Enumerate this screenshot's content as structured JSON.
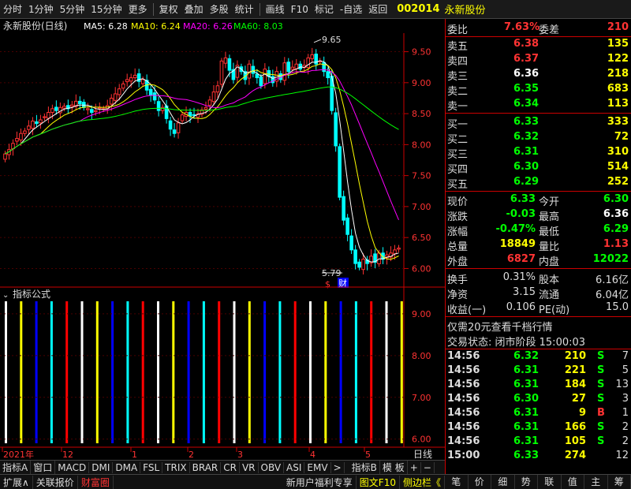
{
  "toolbar": {
    "items": [
      "分时",
      "1分钟",
      "5分钟",
      "15分钟",
      "更多",
      "复权",
      "叠加",
      "多股",
      "统计",
      "画线",
      "F10",
      "标记",
      "-自选",
      "返回"
    ],
    "code": "002014",
    "name": "永新股份"
  },
  "chart_header": {
    "title": "永新股份(日线)",
    "ma5": "MA5: 6.28",
    "ma10": "MA10: 6.24",
    "ma20": "MA20: 6.26",
    "ma60": "MA60: 8.03"
  },
  "indicator_header": "指标公式",
  "annotations": {
    "high": "9.65",
    "low": "5.79",
    "marker1": "$",
    "marker2": "财"
  },
  "xaxis": {
    "labels": [
      "2021年",
      "12",
      "1",
      "2",
      "3",
      "4",
      "5"
    ],
    "period": "日线"
  },
  "colors": {
    "ma5": "#ffffff",
    "ma10": "#ffff00",
    "ma20": "#ff00ff",
    "ma60": "#00ff00",
    "up": "#ff3232",
    "down": "#00ffff",
    "grid": "#8b0000"
  },
  "chart_data": {
    "type": "candlestick",
    "title": "永新股份(日线)",
    "ylim": [
      5.7,
      9.8
    ],
    "y_ticks": [
      6.0,
      6.5,
      7.0,
      7.5,
      8.0,
      8.5,
      9.0,
      9.5
    ],
    "close": [
      7.85,
      7.92,
      8.02,
      8.1,
      8.18,
      8.22,
      8.3,
      8.38,
      8.34,
      8.4,
      8.45,
      8.52,
      8.58,
      8.55,
      8.6,
      8.62,
      8.58,
      8.64,
      8.7,
      8.66,
      8.6,
      8.58,
      8.52,
      8.55,
      8.6,
      8.58,
      8.63,
      8.75,
      8.82,
      8.9,
      8.98,
      9.05,
      9.08,
      9.12,
      9.02,
      9.05,
      8.88,
      8.8,
      8.72,
      8.55,
      8.6,
      8.42,
      8.25,
      8.18,
      8.35,
      8.48,
      8.52,
      8.46,
      8.48,
      8.5,
      8.56,
      8.6,
      8.72,
      8.85,
      8.95,
      9.35,
      9.4,
      9.2,
      9.05,
      9.28,
      9.18,
      9.05,
      9.3,
      9.15,
      9.08,
      8.95,
      9.22,
      9.1,
      9.0,
      9.18,
      9.05,
      9.32,
      9.18,
      9.25,
      9.3,
      9.22,
      9.28,
      9.4,
      9.45,
      9.3,
      9.35,
      9.18,
      9.08,
      8.55,
      7.98,
      7.15,
      6.78,
      6.55,
      6.3,
      6.08,
      6.02,
      6.15,
      6.08,
      6.2,
      6.1,
      6.25,
      6.15,
      6.22,
      6.25,
      6.3,
      6.33
    ],
    "volume_bars": [
      {
        "color": "white"
      },
      {
        "color": "yellow"
      },
      {
        "color": "blue"
      },
      {
        "color": "cyan"
      },
      {
        "color": "red"
      },
      {
        "color": "white"
      },
      {
        "color": "yellow"
      },
      {
        "color": "blue"
      },
      {
        "color": "cyan"
      },
      {
        "color": "red"
      },
      {
        "color": "white"
      },
      {
        "color": "yellow"
      },
      {
        "color": "blue"
      },
      {
        "color": "cyan"
      },
      {
        "color": "red"
      },
      {
        "color": "white"
      },
      {
        "color": "yellow"
      },
      {
        "color": "blue"
      },
      {
        "color": "cyan"
      },
      {
        "color": "red"
      },
      {
        "color": "white"
      },
      {
        "color": "yellow"
      },
      {
        "color": "blue"
      },
      {
        "color": "cyan"
      },
      {
        "color": "red"
      },
      {
        "color": "white"
      },
      {
        "color": "yellow"
      }
    ],
    "indicator_y_ticks": [
      6.0,
      7.0,
      8.0,
      9.0
    ]
  },
  "quote": {
    "weibi_label": "委比",
    "weibi_value": "7.63%",
    "weicha_label": "委差",
    "weicha_value": "210",
    "sells": [
      {
        "label": "卖五",
        "price": "6.38",
        "vol": "135"
      },
      {
        "label": "卖四",
        "price": "6.37",
        "vol": "122"
      },
      {
        "label": "卖三",
        "price": "6.36",
        "vol": "218"
      },
      {
        "label": "卖二",
        "price": "6.35",
        "vol": "683"
      },
      {
        "label": "卖一",
        "price": "6.34",
        "vol": "113"
      }
    ],
    "buys": [
      {
        "label": "买一",
        "price": "6.33",
        "vol": "333"
      },
      {
        "label": "买二",
        "price": "6.32",
        "vol": "72"
      },
      {
        "label": "买三",
        "price": "6.31",
        "vol": "310"
      },
      {
        "label": "买四",
        "price": "6.30",
        "vol": "514"
      },
      {
        "label": "买五",
        "price": "6.29",
        "vol": "252"
      }
    ],
    "stats": [
      {
        "l1": "现价",
        "v1": "6.33",
        "l2": "今开",
        "v2": "6.30"
      },
      {
        "l1": "涨跌",
        "v1": "-0.03",
        "l2": "最高",
        "v2": "6.36"
      },
      {
        "l1": "涨幅",
        "v1": "-0.47%",
        "l2": "最低",
        "v2": "6.29"
      },
      {
        "l1": "总量",
        "v1": "18849",
        "l2": "量比",
        "v2": "1.13"
      },
      {
        "l1": "外盘",
        "v1": "6827",
        "l2": "内盘",
        "v2": "12022"
      }
    ],
    "stats2": [
      {
        "l1": "换手",
        "v1": "0.31%",
        "l2": "股本",
        "v2": "6.16亿"
      },
      {
        "l1": "净资",
        "v1": "3.15",
        "l2": "流通",
        "v2": "6.04亿"
      },
      {
        "l1": "收益(一)",
        "v1": "0.106",
        "l2": "PE(动)",
        "v2": "15.0"
      }
    ],
    "promo": "仅需20元查看千档行情",
    "status": "交易状态: 闭市阶段 15:00:03"
  },
  "ticks": [
    {
      "t": "14:56",
      "p": "6.32",
      "v": "210",
      "s": "S",
      "n": "7"
    },
    {
      "t": "14:56",
      "p": "6.31",
      "v": "221",
      "s": "S",
      "n": "5"
    },
    {
      "t": "14:56",
      "p": "6.31",
      "v": "184",
      "s": "S",
      "n": "13"
    },
    {
      "t": "14:56",
      "p": "6.30",
      "v": "27",
      "s": "S",
      "n": "3"
    },
    {
      "t": "14:56",
      "p": "6.31",
      "v": "9",
      "s": "B",
      "n": "1"
    },
    {
      "t": "14:56",
      "p": "6.31",
      "v": "166",
      "s": "S",
      "n": "2"
    },
    {
      "t": "14:56",
      "p": "6.31",
      "v": "105",
      "s": "S",
      "n": "2"
    },
    {
      "t": "15:00",
      "p": "6.33",
      "v": "274",
      "s": "",
      "n": "12"
    }
  ],
  "bottom_tabs": [
    "指标A",
    "窗口",
    "MACD",
    "DMI",
    "DMA",
    "FSL",
    "TRIX",
    "BRAR",
    "CR",
    "VR",
    "OBV",
    "ASI",
    "EMV",
    ">",
    "指标B",
    "模 板",
    "+",
    "−"
  ],
  "status_bar": {
    "left": [
      "扩展∧",
      "关联报价",
      "财富圈"
    ],
    "right": [
      "新用户福利专享",
      "图文F10",
      "侧边栏《"
    ]
  },
  "right_tabs": [
    "笔",
    "价",
    "细",
    "势",
    "联",
    "值",
    "主",
    "筹"
  ]
}
